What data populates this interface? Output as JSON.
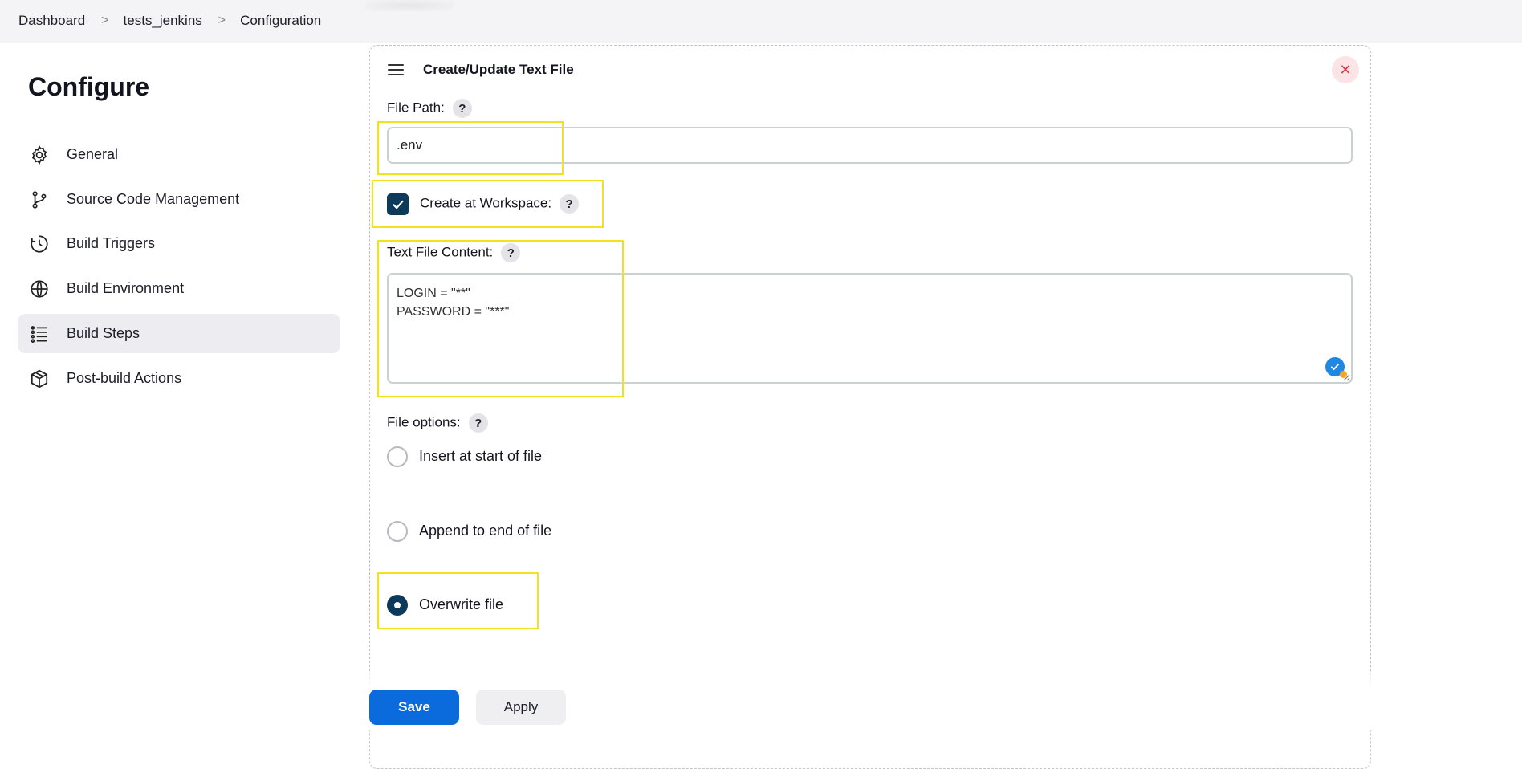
{
  "breadcrumb": {
    "items": [
      "Dashboard",
      "tests_jenkins",
      "Configuration"
    ]
  },
  "sidebar": {
    "title": "Configure",
    "items": [
      {
        "label": "General",
        "icon": "gear-icon"
      },
      {
        "label": "Source Code Management",
        "icon": "branch-icon"
      },
      {
        "label": "Build Triggers",
        "icon": "clock-icon"
      },
      {
        "label": "Build Environment",
        "icon": "globe-icon"
      },
      {
        "label": "Build Steps",
        "icon": "list-icon",
        "active": true
      },
      {
        "label": "Post-build Actions",
        "icon": "package-icon"
      }
    ]
  },
  "step": {
    "title": "Create/Update Text File",
    "file_path_label": "File Path:",
    "file_path_value": ".env",
    "create_workspace_label": "Create at Workspace:",
    "create_workspace_checked": true,
    "content_label": "Text File Content:",
    "content_lines": [
      "LOGIN = \"**\"",
      "PASSWORD = \"***\""
    ],
    "file_options_label": "File options:",
    "options": [
      {
        "label": "Insert at start of file",
        "selected": false
      },
      {
        "label": "Append to end of file",
        "selected": false
      },
      {
        "label": "Overwrite file",
        "selected": true
      }
    ],
    "help_glyph": "?",
    "close_glyph": "✕"
  },
  "actions": {
    "save_label": "Save",
    "apply_label": "Apply"
  },
  "colors": {
    "primary": "#0b6bdc",
    "checked": "#0b3a5b",
    "highlight": "#f0e121",
    "close": "#e03848"
  }
}
